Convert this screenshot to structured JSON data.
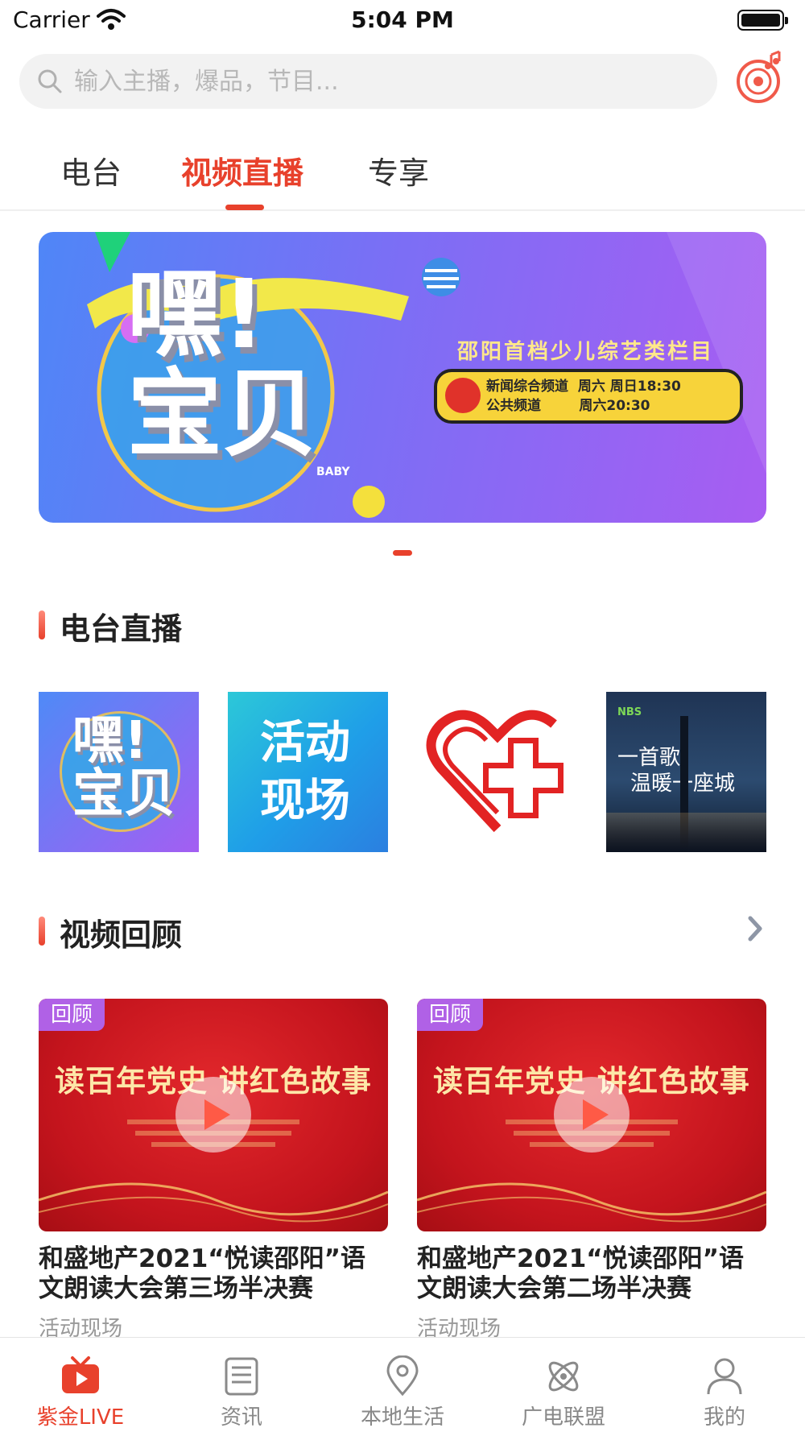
{
  "status_bar": {
    "carrier": "Carrier",
    "time": "5:04 PM"
  },
  "search": {
    "placeholder": "输入主播，爆品，节目..."
  },
  "tabs": [
    {
      "label": "电台",
      "active": false
    },
    {
      "label": "视频直播",
      "active": true
    },
    {
      "label": "专享",
      "active": false
    }
  ],
  "banner": {
    "title_line1": "嘿!",
    "title_line2": "宝贝",
    "baby": "BABY",
    "subtitle": "邵阳首档少儿综艺类栏目",
    "schedule": [
      {
        "channel": "新闻综合频道",
        "time": "周六 周日18:30"
      },
      {
        "channel": "公共频道",
        "time": "周六20:30"
      }
    ]
  },
  "radio_section": {
    "title": "电台直播",
    "items": [
      {
        "name": "嘿!宝贝",
        "line1": "嘿!",
        "line2": "宝贝"
      },
      {
        "name": "活动现场",
        "line1": "活动",
        "line2": "现场"
      },
      {
        "name": "红心"
      },
      {
        "name": "一首歌温暖一座城",
        "brand": "NBS",
        "line1": "一首歌",
        "line2": "温暖一座城"
      }
    ]
  },
  "video_section": {
    "title": "视频回顾",
    "cards": [
      {
        "badge": "回顾",
        "headline": "读百年党史 讲红色故事",
        "title": "和盛地产2021“悦读邵阳”语文朗读大会第三场半决赛",
        "category": "活动现场"
      },
      {
        "badge": "回顾",
        "headline": "读百年党史 讲红色故事",
        "title": "和盛地产2021“悦读邵阳”语文朗读大会第二场半决赛",
        "category": "活动现场"
      }
    ]
  },
  "tab_bar": [
    {
      "label": "紫金LIVE",
      "icon": "tv-icon",
      "active": true
    },
    {
      "label": "资讯",
      "icon": "news-icon",
      "active": false
    },
    {
      "label": "本地生活",
      "icon": "location-icon",
      "active": false
    },
    {
      "label": "广电联盟",
      "icon": "atom-icon",
      "active": false
    },
    {
      "label": "我的",
      "icon": "user-icon",
      "active": false
    }
  ],
  "colors": {
    "accent": "#e8412c",
    "badge": "#b061e6"
  }
}
